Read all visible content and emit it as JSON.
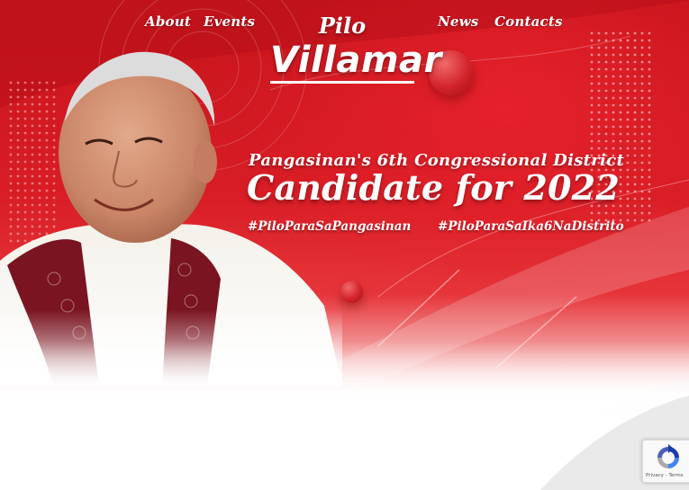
{
  "nav": {
    "about": "About",
    "events": "Events",
    "news": "News",
    "contacts": "Contacts"
  },
  "logo": {
    "first_name": "Pilo",
    "last_name": "Villamar"
  },
  "hero": {
    "district": "Pangasinan's 6th Congressional District",
    "headline": "Candidate for 2022",
    "hashtag_1": "#PiloParaSaPangasinan",
    "hashtag_2": "#PiloParaSaIka6NaDistrito"
  },
  "recaptcha": {
    "links": "Privacy - Terms"
  },
  "colors": {
    "primary_red": "#d81d25",
    "text": "#ffffff",
    "sash_maroon": "#7a1420"
  },
  "icons": [
    "recaptcha-icon"
  ]
}
